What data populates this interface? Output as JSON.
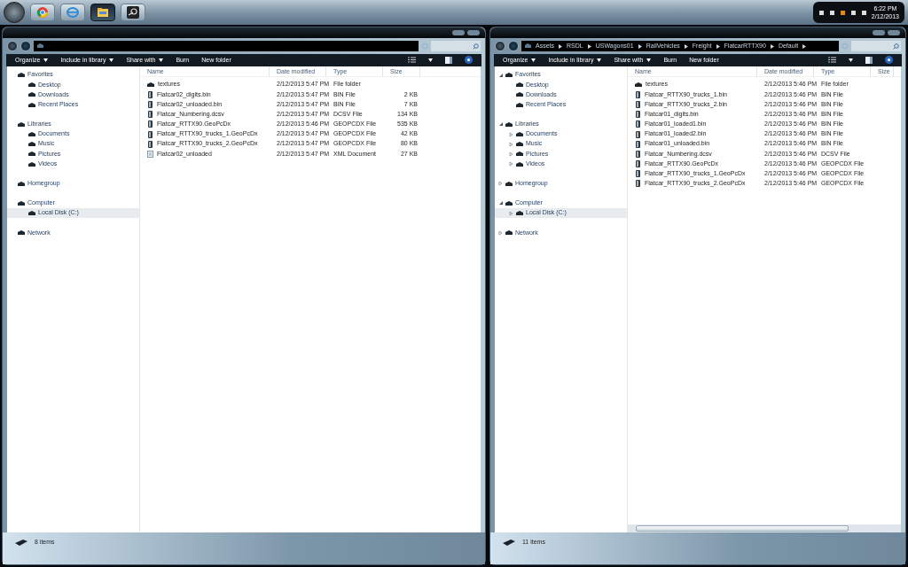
{
  "taskbar": {
    "apps": [
      {
        "selected": false
      },
      {
        "selected": false
      },
      {
        "selected": true
      },
      {
        "selected": false
      }
    ],
    "clock": {
      "time": "6:22 PM",
      "date": "2/12/2013"
    }
  },
  "windows": [
    {
      "toolbar": [
        {
          "label": "Organize",
          "dropdown": true
        },
        {
          "label": "Include in library",
          "dropdown": true
        },
        {
          "label": "Share with",
          "dropdown": true
        },
        {
          "label": "Burn",
          "dropdown": false
        },
        {
          "label": "New folder",
          "dropdown": false
        }
      ],
      "nav": [
        {
          "label": "Favorites",
          "selected": false,
          "children": [
            {
              "label": "Desktop",
              "selected": false
            },
            {
              "label": "Downloads",
              "selected": false
            },
            {
              "label": "Recent Places",
              "selected": false
            }
          ]
        },
        {
          "label": "Libraries",
          "selected": false,
          "children": [
            {
              "label": "Documents",
              "selected": false
            },
            {
              "label": "Music",
              "selected": false
            },
            {
              "label": "Pictures",
              "selected": false
            },
            {
              "label": "Videos",
              "selected": false
            }
          ]
        },
        {
          "label": "Homegroup",
          "selected": false
        },
        {
          "label": "Computer",
          "selected": false,
          "children": [
            {
              "label": "Local Disk (C:)",
              "selected": true
            }
          ]
        },
        {
          "label": "Network",
          "selected": false
        }
      ],
      "columns": [
        "Name",
        "Date modified",
        "Type",
        "Size"
      ],
      "files": [
        {
          "kind": "folder",
          "name": "textures",
          "date": "2/12/2013 5:47 PM",
          "type": "File folder"
        },
        {
          "kind": "file",
          "name": "Flatcar02_digits.bin",
          "date": "2/12/2013 5:47 PM",
          "type": "BIN File",
          "size": "2 KB"
        },
        {
          "kind": "file",
          "name": "Flatcar02_unloaded.bin",
          "date": "2/12/2013 5:47 PM",
          "type": "BIN File",
          "size": "7 KB"
        },
        {
          "kind": "file",
          "name": "Flatcar_Numbering.dcsv",
          "date": "2/12/2013 5:47 PM",
          "type": "DCSV File",
          "size": "134 KB"
        },
        {
          "kind": "file",
          "name": "Flatcar_RTTX90.GeoPcDx",
          "date": "2/12/2013 5:46 PM",
          "type": "GEOPCDX File",
          "size": "535 KB"
        },
        {
          "kind": "file",
          "name": "Flatcar_RTTX90_trucks_1.GeoPcDx",
          "date": "2/12/2013 5:47 PM",
          "type": "GEOPCDX File",
          "size": "42 KB"
        },
        {
          "kind": "file",
          "name": "Flatcar_RTTX90_trucks_2.GeoPcDx",
          "date": "2/12/2013 5:47 PM",
          "type": "GEOPCDX File",
          "size": "80 KB"
        },
        {
          "kind": "document",
          "name": "Flatcar02_unloaded",
          "date": "2/12/2013 5:47 PM",
          "type": "XML Document",
          "size": "27 KB"
        }
      ],
      "hscroll": false,
      "status": "8 items"
    },
    {
      "address": {
        "breadcrumb": [
          "Assets",
          "RSDL",
          "USWagons01",
          "RailVehicles",
          "Freight",
          "FlatcarRTTX90",
          "Default"
        ]
      },
      "toolbar": [
        {
          "label": "Organize",
          "dropdown": true
        },
        {
          "label": "Include in library",
          "dropdown": true
        },
        {
          "label": "Share with",
          "dropdown": true
        },
        {
          "label": "Burn",
          "dropdown": false
        },
        {
          "label": "New folder",
          "dropdown": false
        }
      ],
      "nav": [
        {
          "label": "Favorites",
          "selected": false,
          "expanded": true,
          "children": [
            {
              "label": "Desktop",
              "selected": false
            },
            {
              "label": "Downloads",
              "selected": false
            },
            {
              "label": "Recent Places",
              "selected": false
            }
          ]
        },
        {
          "label": "Libraries",
          "selected": false,
          "expanded": true,
          "children": [
            {
              "label": "Documents",
              "selected": false,
              "expanded": false
            },
            {
              "label": "Music",
              "selected": false,
              "expanded": false
            },
            {
              "label": "Pictures",
              "selected": false,
              "expanded": false
            },
            {
              "label": "Videos",
              "selected": false,
              "expanded": false
            }
          ]
        },
        {
          "label": "Homegroup",
          "selected": false,
          "expanded": false
        },
        {
          "label": "Computer",
          "selected": false,
          "expanded": true,
          "children": [
            {
              "label": "Local Disk (C:)",
              "selected": true,
              "expanded": false
            }
          ]
        },
        {
          "label": "Network",
          "selected": false,
          "expanded": false
        }
      ],
      "columns": [
        "Name",
        "Date modified",
        "Type",
        "Size"
      ],
      "files": [
        {
          "kind": "folder",
          "name": "textures",
          "date": "2/12/2013 5:46 PM",
          "type": "File folder"
        },
        {
          "kind": "file",
          "name": "Flatcar_RTTX90_trucks_1.bin",
          "date": "2/12/2013 5:46 PM",
          "type": "BIN File"
        },
        {
          "kind": "file",
          "name": "Flatcar_RTTX90_trucks_2.bin",
          "date": "2/12/2013 5:46 PM",
          "type": "BIN File"
        },
        {
          "kind": "file",
          "name": "Flatcar01_digits.bin",
          "date": "2/12/2013 5:46 PM",
          "type": "BIN File"
        },
        {
          "kind": "file",
          "name": "Flatcar01_loaded1.bin",
          "date": "2/12/2013 5:46 PM",
          "type": "BIN File"
        },
        {
          "kind": "file",
          "name": "Flatcar01_loaded2.bin",
          "date": "2/12/2013 5:46 PM",
          "type": "BIN File"
        },
        {
          "kind": "file",
          "name": "Flatcar01_unloaded.bin",
          "date": "2/12/2013 5:46 PM",
          "type": "BIN File"
        },
        {
          "kind": "file",
          "name": "Flatcar_Numbering.dcsv",
          "date": "2/12/2013 5:46 PM",
          "type": "DCSV File"
        },
        {
          "kind": "file",
          "name": "Flatcar_RTTX90.GeoPcDx",
          "date": "2/12/2013 5:46 PM",
          "type": "GEOPCDX File"
        },
        {
          "kind": "file",
          "name": "Flatcar_RTTX90_trucks_1.GeoPcDx",
          "date": "2/12/2013 5:46 PM",
          "type": "GEOPCDX File"
        },
        {
          "kind": "file",
          "name": "Flatcar_RTTX90_trucks_2.GeoPcDx",
          "date": "2/12/2013 5:46 PM",
          "type": "GEOPCDX File"
        }
      ],
      "hscroll": true,
      "status": "11 items"
    }
  ]
}
